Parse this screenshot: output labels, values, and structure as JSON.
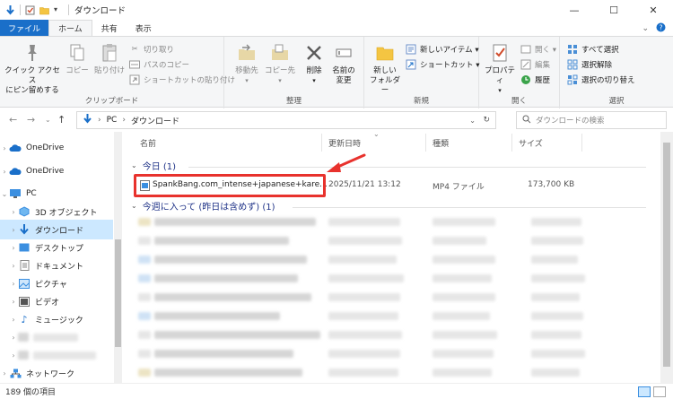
{
  "window": {
    "title": "ダウンロード",
    "controls": [
      "—",
      "☐",
      "✕"
    ]
  },
  "ribbon_tabs": [
    "ファイル",
    "ホーム",
    "共有",
    "表示"
  ],
  "ribbon": {
    "clipboard": {
      "pin_line1": "クイック アクセス",
      "pin_line2": "にピン留めする",
      "copy": "コピー",
      "paste": "貼り付け",
      "cut": "切り取り",
      "copy_path": "パスのコピー",
      "paste_shortcut": "ショートカットの貼り付け",
      "label": "クリップボード"
    },
    "organize": {
      "move_to": "移動先",
      "copy_to": "コピー先",
      "delete": "削除",
      "rename_line1": "名前の",
      "rename_line2": "変更",
      "label": "整理"
    },
    "new": {
      "new_folder_line1": "新しい",
      "new_folder_line2": "フォルダー",
      "new_item": "新しいアイテム ▾",
      "shortcut": "ショートカット ▾",
      "label": "新規"
    },
    "open": {
      "properties": "プロパティ",
      "open": "開く ▾",
      "edit": "編集",
      "history": "履歴",
      "label": "開く"
    },
    "select": {
      "select_all": "すべて選択",
      "select_none": "選択解除",
      "invert": "選択の切り替え",
      "label": "選択"
    }
  },
  "address": {
    "path": [
      "PC",
      "ダウンロード"
    ],
    "search_placeholder": "ダウンロードの検索"
  },
  "nav": {
    "items": [
      {
        "label": "OneDrive"
      },
      {
        "label": "OneDrive"
      },
      {
        "label": "PC"
      },
      {
        "label": "3D オブジェクト"
      },
      {
        "label": "ダウンロード"
      },
      {
        "label": "デスクトップ"
      },
      {
        "label": "ドキュメント"
      },
      {
        "label": "ピクチャ"
      },
      {
        "label": "ビデオ"
      },
      {
        "label": "ミュージック"
      },
      {
        "label": "ネットワーク"
      }
    ]
  },
  "columns": [
    "名前",
    "更新日時",
    "種類",
    "サイズ"
  ],
  "groups": {
    "today": "今日 (1)",
    "this_week": "今週に入って (昨日は含めず) (1)"
  },
  "file": {
    "name": "SpankBang.com_intense+japanese+kare...",
    "modified": "2025/11/21 13:12",
    "type": "MP4 ファイル",
    "size": "173,700 KB"
  },
  "status": {
    "count": "189 個の項目"
  },
  "colors": {
    "accent": "#1a6fc9",
    "selection": "#cce8ff",
    "highlight": "#e8322d",
    "group_text": "#1e3287"
  }
}
